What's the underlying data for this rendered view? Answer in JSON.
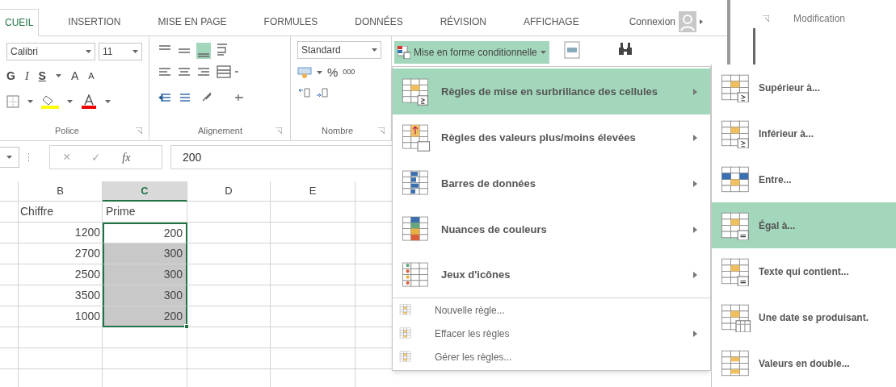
{
  "ribbon_tabs": [
    {
      "label": "CUEIL",
      "selected": true
    },
    {
      "label": "INSERTION",
      "selected": false
    },
    {
      "label": "MISE EN PAGE",
      "selected": false
    },
    {
      "label": "FORMULES",
      "selected": false
    },
    {
      "label": "DONNÉES",
      "selected": false
    },
    {
      "label": "RÉVISION",
      "selected": false
    },
    {
      "label": "AFFICHAGE",
      "selected": false
    }
  ],
  "account": {
    "label": "Connexion"
  },
  "ribbon": {
    "font": {
      "name": "Calibri",
      "size": "11",
      "bold": "G",
      "italic": "I",
      "underline": "S",
      "grow": "A",
      "shrink": "A",
      "group": "Police"
    },
    "alignment": {
      "group": "Alignement"
    },
    "number": {
      "format": "Standard",
      "percent": "%",
      "thousands": "000",
      "group": "Nombre"
    },
    "conditional_button": {
      "label": "Mise en forme conditionnelle",
      "expanded": true
    },
    "editing_group": "Modification"
  },
  "formula_bar": {
    "cancel": "×",
    "enter": "✓",
    "function": "fx",
    "value": "200"
  },
  "sheet": {
    "columns": [
      {
        "label": "B",
        "selected": false
      },
      {
        "label": "C",
        "selected": true
      },
      {
        "label": "D",
        "selected": false
      },
      {
        "label": "E",
        "selected": false
      }
    ],
    "rows": [
      {
        "b": "Chiffre",
        "c": "Prime",
        "selected": false
      },
      {
        "b": "1200",
        "c": "200",
        "selected": true
      },
      {
        "b": "2700",
        "c": "300",
        "selected": true
      },
      {
        "b": "2500",
        "c": "300",
        "selected": true
      },
      {
        "b": "3500",
        "c": "300",
        "selected": true
      },
      {
        "b": "1000",
        "c": "200",
        "selected": true
      }
    ]
  },
  "menu": {
    "items": [
      {
        "kind": "large",
        "label": "Règles de mise en surbrillance des cellules",
        "submenu": true,
        "selected": true
      },
      {
        "kind": "large",
        "label": "Règles des valeurs plus/moins élevées",
        "submenu": true,
        "selected": false
      },
      {
        "kind": "large",
        "label": "Barres de données",
        "submenu": true,
        "selected": false
      },
      {
        "kind": "large",
        "label": "Nuances de couleurs",
        "submenu": true,
        "selected": false
      },
      {
        "kind": "large",
        "label": "Jeux d'icônes",
        "submenu": true,
        "selected": false
      },
      {
        "kind": "small",
        "label": "Nouvelle règle...",
        "submenu": false,
        "selected": false
      },
      {
        "kind": "small",
        "label": "Effacer les règles",
        "submenu": true,
        "selected": false
      },
      {
        "kind": "small",
        "label": "Gérer les règles...",
        "submenu": false,
        "selected": false
      }
    ]
  },
  "submenu": {
    "items": [
      {
        "label": "Supérieur à...",
        "selected": false
      },
      {
        "label": "Inférieur à...",
        "selected": false
      },
      {
        "label": "Entre...",
        "selected": false
      },
      {
        "label": "Égal à...",
        "selected": true
      },
      {
        "label": "Texte qui contient...",
        "selected": false
      },
      {
        "label": "Une date se produisant.",
        "selected": false
      },
      {
        "label": "Valeurs en double...",
        "selected": false
      }
    ]
  }
}
